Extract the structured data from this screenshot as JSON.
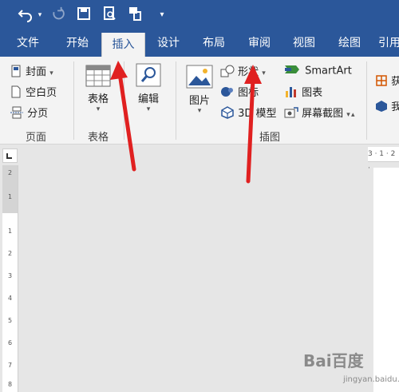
{
  "tabs": [
    {
      "label": "文件"
    },
    {
      "label": "开始"
    },
    {
      "label": "插入"
    },
    {
      "label": "设计"
    },
    {
      "label": "布局"
    },
    {
      "label": "审阅"
    },
    {
      "label": "视图"
    },
    {
      "label": "绘图"
    },
    {
      "label": "引用"
    }
  ],
  "active_tab": "插入",
  "ribbon": {
    "pages": {
      "cover": "封面",
      "blank": "空白页",
      "break": "分页",
      "group": "页面"
    },
    "table": {
      "button": "表格",
      "group": "表格"
    },
    "edit": {
      "button": "编辑"
    },
    "illustrations": {
      "picture": "图片",
      "shapes": "形状",
      "icons": "图标",
      "model3d": "3D 模型",
      "smartart": "SmartArt",
      "chart": "图表",
      "screenshot": "屏幕截图",
      "group": "插图"
    },
    "addins_partial": {
      "get": "获",
      "my": "我"
    }
  },
  "ruler": {
    "top": "3 · 1 · 2 ·",
    "left": [
      "2",
      "1",
      "1",
      "2",
      "3",
      "4",
      "5",
      "6",
      "7",
      "8"
    ]
  },
  "colors": {
    "accent": "#2b579a",
    "arrow": "#e02020"
  },
  "watermark": {
    "logo": "Bai百度",
    "sub": "经验",
    "url": "jingyan.baidu.com"
  }
}
